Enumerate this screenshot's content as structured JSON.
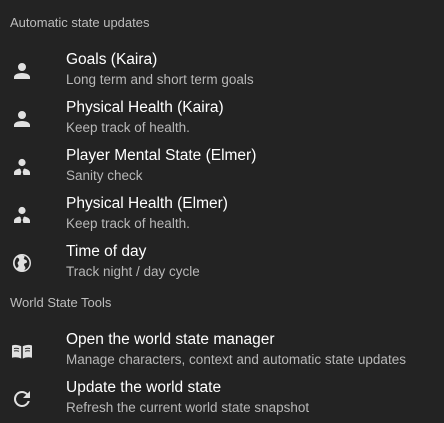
{
  "sections": [
    {
      "header": "Automatic state updates",
      "items": [
        {
          "icon": "person-icon",
          "title": "Goals (Kaira)",
          "subtitle": "Long term and short term goals"
        },
        {
          "icon": "person-icon",
          "title": "Physical Health (Kaira)",
          "subtitle": "Keep track of health."
        },
        {
          "icon": "person-tie-icon",
          "title": "Player Mental State (Elmer)",
          "subtitle": "Sanity check"
        },
        {
          "icon": "person-tie-icon",
          "title": "Physical Health (Elmer)",
          "subtitle": "Keep track of health."
        },
        {
          "icon": "globe-icon",
          "title": "Time of day",
          "subtitle": "Track night / day cycle"
        }
      ]
    },
    {
      "header": "World State Tools",
      "items": [
        {
          "icon": "book-open-icon",
          "title": "Open the world state manager",
          "subtitle": "Manage characters, context and automatic state updates"
        },
        {
          "icon": "refresh-icon",
          "title": "Update the world state",
          "subtitle": "Refresh the current world state snapshot"
        }
      ]
    }
  ],
  "colors": {
    "background": "#232323",
    "title": "#ffffff",
    "subtitle": "#b8b8b8",
    "header": "#bdbdbd",
    "icon": "#e0e0e0"
  }
}
